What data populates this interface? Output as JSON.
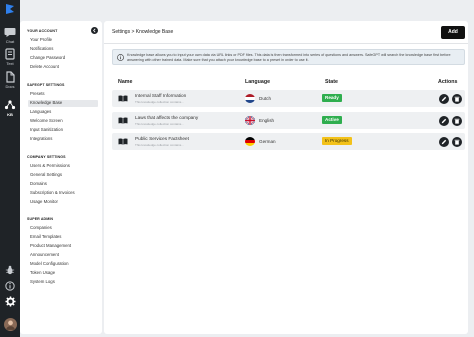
{
  "rail": {
    "items": [
      {
        "label": "Chat"
      },
      {
        "label": "Text"
      },
      {
        "label": "Docs"
      },
      {
        "label": "KB"
      }
    ]
  },
  "menu": {
    "sections": [
      {
        "title": "YOUR ACCOUNT",
        "items": [
          "Your Profile",
          "Notifications",
          "Change Password",
          "Delete Account"
        ]
      },
      {
        "title": "SAFEGPT SETTINGS",
        "items": [
          "Presets",
          "Knowledge Base",
          "Languages",
          "Welcome Screen",
          "Input Sanitization",
          "Integrations"
        ]
      },
      {
        "title": "COMPANY SETTINGS",
        "items": [
          "Users & Permissions",
          "General Settings",
          "Domains",
          "Subscription & Invoices",
          "Usage Monitor"
        ]
      },
      {
        "title": "SUPER ADMIN",
        "items": [
          "Companies",
          "Email Templates",
          "Product Management",
          "Announcement",
          "Model Configuration",
          "Token Usage",
          "System Logs"
        ]
      }
    ],
    "active_item": "Knowledge Base"
  },
  "header": {
    "breadcrumb": "Settings > Knowledge Base",
    "add_label": "Add"
  },
  "info": {
    "text": "Knowledge base allows you to input your own data via URL links or PDF files. This data is then transformed into series of questions and answers. SafeGPT will search the knowledge base first before answering with other trained data. Make sure that you attach your knowledge base to a preset in order to use it."
  },
  "table": {
    "columns": {
      "name": "Name",
      "language": "Language",
      "state": "State",
      "actions": "Actions"
    },
    "rows": [
      {
        "name": "Internal Staff Information",
        "desc": "This knowledge collection contains...",
        "language": "Dutch",
        "flag": "nl",
        "state": "Ready",
        "state_kind": "ready"
      },
      {
        "name": "Laws that affects the company",
        "desc": "This knowledge collection contains...",
        "language": "English",
        "flag": "uk",
        "state": "Active",
        "state_kind": "ready"
      },
      {
        "name": "Public Services Factsheet",
        "desc": "This knowledge collection contains...",
        "language": "German",
        "flag": "de",
        "state": "In Progress",
        "state_kind": "progress"
      }
    ]
  }
}
